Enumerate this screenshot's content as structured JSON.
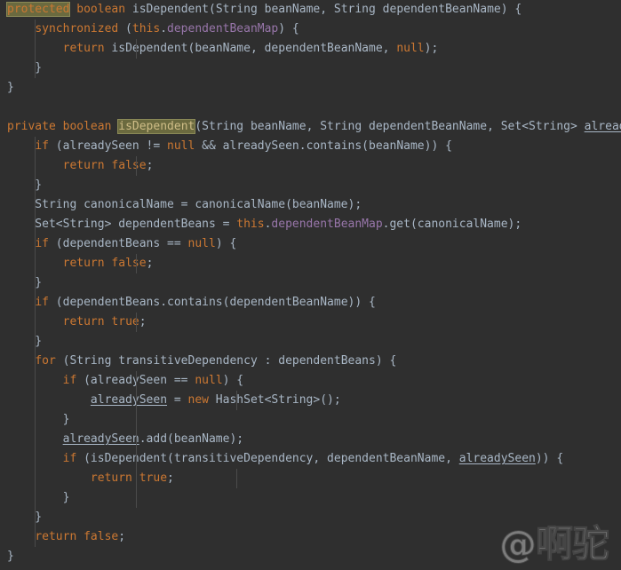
{
  "editor": {
    "language": "java",
    "background_color": "#2f2f2f",
    "default_text_color": "#a9b7c6",
    "keyword_color": "#cc7832",
    "field_color": "#9876aa",
    "indent_guide_color": "#4b4b4b",
    "search_highlight_color": "#6b6a3f",
    "search_highlight_border_color": "#8a8957"
  },
  "watermark": {
    "text": "@啊驼",
    "color": "#8a8a8a"
  },
  "code": {
    "lines": [
      {
        "n": 1,
        "guides": [],
        "text": "protected boolean isDependent(String beanName, String dependentBeanName) {"
      },
      {
        "n": 2,
        "guides": [
          8
        ],
        "text": "    synchronized (this.dependentBeanMap) {"
      },
      {
        "n": 3,
        "guides": [
          8,
          37
        ],
        "text": "        return isDependent(beanName, dependentBeanName, null);"
      },
      {
        "n": 4,
        "guides": [
          8
        ],
        "text": "    }"
      },
      {
        "n": 5,
        "guides": [],
        "text": "}"
      },
      {
        "n": 6,
        "guides": [],
        "text": ""
      },
      {
        "n": 7,
        "guides": [],
        "text": "private boolean isDependent(String beanName, String dependentBeanName, Set<String> alreadySeen) {"
      },
      {
        "n": 8,
        "guides": [
          8
        ],
        "text": "    if (alreadySeen != null && alreadySeen.contains(beanName)) {"
      },
      {
        "n": 9,
        "guides": [
          8,
          37
        ],
        "text": "        return false;"
      },
      {
        "n": 10,
        "guides": [
          8
        ],
        "text": "    }"
      },
      {
        "n": 11,
        "guides": [
          8
        ],
        "text": "    String canonicalName = canonicalName(beanName);"
      },
      {
        "n": 12,
        "guides": [
          8
        ],
        "text": "    Set<String> dependentBeans = this.dependentBeanMap.get(canonicalName);"
      },
      {
        "n": 13,
        "guides": [
          8
        ],
        "text": "    if (dependentBeans == null) {"
      },
      {
        "n": 14,
        "guides": [
          8,
          37
        ],
        "text": "        return false;"
      },
      {
        "n": 15,
        "guides": [
          8
        ],
        "text": "    }"
      },
      {
        "n": 16,
        "guides": [
          8
        ],
        "text": "    if (dependentBeans.contains(dependentBeanName)) {"
      },
      {
        "n": 17,
        "guides": [
          8,
          37
        ],
        "text": "        return true;"
      },
      {
        "n": 18,
        "guides": [
          8
        ],
        "text": "    }"
      },
      {
        "n": 19,
        "guides": [
          8
        ],
        "text": "    for (String transitiveDependency : dependentBeans) {"
      },
      {
        "n": 20,
        "guides": [
          8,
          37
        ],
        "text": "        if (alreadySeen == null) {"
      },
      {
        "n": 21,
        "guides": [
          8,
          37,
          66
        ],
        "text": "            alreadySeen = new HashSet<String>();"
      },
      {
        "n": 22,
        "guides": [
          8,
          37
        ],
        "text": "        }"
      },
      {
        "n": 23,
        "guides": [
          8,
          37
        ],
        "text": "        alreadySeen.add(beanName);"
      },
      {
        "n": 24,
        "guides": [
          8,
          37
        ],
        "text": "        if (isDependent(transitiveDependency, dependentBeanName, alreadySeen)) {"
      },
      {
        "n": 25,
        "guides": [
          8,
          37,
          66
        ],
        "text": "            return true;"
      },
      {
        "n": 26,
        "guides": [
          8,
          37
        ],
        "text": "        }"
      },
      {
        "n": 27,
        "guides": [
          8
        ],
        "text": "    }"
      },
      {
        "n": 28,
        "guides": [
          8
        ],
        "text": "    return false;"
      },
      {
        "n": 29,
        "guides": [],
        "text": "}"
      }
    ],
    "tokens": [
      {
        "line": 1,
        "parts": [
          {
            "t": "protected",
            "c": "hl"
          },
          {
            "t": " ",
            "c": "txt"
          },
          {
            "t": "boolean",
            "c": "kw"
          },
          {
            "t": " isDependent(String beanName, String dependentBeanName) {",
            "c": "txt"
          }
        ]
      },
      {
        "line": 2,
        "parts": [
          {
            "t": "    ",
            "c": "txt"
          },
          {
            "t": "synchronized",
            "c": "kw"
          },
          {
            "t": " (",
            "c": "txt"
          },
          {
            "t": "this",
            "c": "kw"
          },
          {
            "t": ".",
            "c": "txt"
          },
          {
            "t": "dependentBeanMap",
            "c": "fld"
          },
          {
            "t": ") {",
            "c": "txt"
          }
        ]
      },
      {
        "line": 3,
        "parts": [
          {
            "t": "        ",
            "c": "txt"
          },
          {
            "t": "return",
            "c": "kw"
          },
          {
            "t": " isDependent(beanName, dependentBeanName, ",
            "c": "txt"
          },
          {
            "t": "null",
            "c": "kw"
          },
          {
            "t": ");",
            "c": "txt"
          }
        ]
      },
      {
        "line": 4,
        "parts": [
          {
            "t": "    }",
            "c": "txt"
          }
        ]
      },
      {
        "line": 5,
        "parts": [
          {
            "t": "}",
            "c": "txt"
          }
        ]
      },
      {
        "line": 6,
        "parts": [
          {
            "t": "",
            "c": "txt"
          }
        ]
      },
      {
        "line": 7,
        "parts": [
          {
            "t": "private",
            "c": "kw"
          },
          {
            "t": " ",
            "c": "txt"
          },
          {
            "t": "boolean",
            "c": "kw"
          },
          {
            "t": " ",
            "c": "txt"
          },
          {
            "t": "isDependent",
            "c": "hl2"
          },
          {
            "t": "(String beanName, String dependentBeanName, Set<String> ",
            "c": "txt"
          },
          {
            "t": "alreadySeen",
            "c": "param"
          },
          {
            "t": ") {",
            "c": "txt"
          }
        ]
      },
      {
        "line": 8,
        "parts": [
          {
            "t": "    ",
            "c": "txt"
          },
          {
            "t": "if",
            "c": "kw"
          },
          {
            "t": " (alreadySeen != ",
            "c": "txt"
          },
          {
            "t": "null",
            "c": "kw"
          },
          {
            "t": " && alreadySeen.contains(beanName)) {",
            "c": "txt"
          }
        ]
      },
      {
        "line": 9,
        "parts": [
          {
            "t": "        ",
            "c": "txt"
          },
          {
            "t": "return",
            "c": "kw"
          },
          {
            "t": " ",
            "c": "txt"
          },
          {
            "t": "false",
            "c": "kw"
          },
          {
            "t": ";",
            "c": "txt"
          }
        ]
      },
      {
        "line": 10,
        "parts": [
          {
            "t": "    }",
            "c": "txt"
          }
        ]
      },
      {
        "line": 11,
        "parts": [
          {
            "t": "    String canonicalName = canonicalName(beanName);",
            "c": "txt"
          }
        ]
      },
      {
        "line": 12,
        "parts": [
          {
            "t": "    Set<String> dependentBeans = ",
            "c": "txt"
          },
          {
            "t": "this",
            "c": "kw"
          },
          {
            "t": ".",
            "c": "txt"
          },
          {
            "t": "dependentBeanMap",
            "c": "fld"
          },
          {
            "t": ".get(canonicalName);",
            "c": "txt"
          }
        ]
      },
      {
        "line": 13,
        "parts": [
          {
            "t": "    ",
            "c": "txt"
          },
          {
            "t": "if",
            "c": "kw"
          },
          {
            "t": " (dependentBeans == ",
            "c": "txt"
          },
          {
            "t": "null",
            "c": "kw"
          },
          {
            "t": ") {",
            "c": "txt"
          }
        ]
      },
      {
        "line": 14,
        "parts": [
          {
            "t": "        ",
            "c": "txt"
          },
          {
            "t": "return",
            "c": "kw"
          },
          {
            "t": " ",
            "c": "txt"
          },
          {
            "t": "false",
            "c": "kw"
          },
          {
            "t": ";",
            "c": "txt"
          }
        ]
      },
      {
        "line": 15,
        "parts": [
          {
            "t": "    }",
            "c": "txt"
          }
        ]
      },
      {
        "line": 16,
        "parts": [
          {
            "t": "    ",
            "c": "txt"
          },
          {
            "t": "if",
            "c": "kw"
          },
          {
            "t": " (dependentBeans.contains(dependentBeanName)) {",
            "c": "txt"
          }
        ]
      },
      {
        "line": 17,
        "parts": [
          {
            "t": "        ",
            "c": "txt"
          },
          {
            "t": "return",
            "c": "kw"
          },
          {
            "t": " ",
            "c": "txt"
          },
          {
            "t": "true",
            "c": "kw"
          },
          {
            "t": ";",
            "c": "txt"
          }
        ]
      },
      {
        "line": 18,
        "parts": [
          {
            "t": "    }",
            "c": "txt"
          }
        ]
      },
      {
        "line": 19,
        "parts": [
          {
            "t": "    ",
            "c": "txt"
          },
          {
            "t": "for",
            "c": "kw"
          },
          {
            "t": " (String transitiveDependency : dependentBeans) {",
            "c": "txt"
          }
        ]
      },
      {
        "line": 20,
        "parts": [
          {
            "t": "        ",
            "c": "txt"
          },
          {
            "t": "if",
            "c": "kw"
          },
          {
            "t": " (alreadySeen == ",
            "c": "txt"
          },
          {
            "t": "null",
            "c": "kw"
          },
          {
            "t": ") {",
            "c": "txt"
          }
        ]
      },
      {
        "line": 21,
        "parts": [
          {
            "t": "            ",
            "c": "txt"
          },
          {
            "t": "alreadySeen",
            "c": "param"
          },
          {
            "t": " = ",
            "c": "txt"
          },
          {
            "t": "new",
            "c": "kw"
          },
          {
            "t": " HashSet<String>();",
            "c": "txt"
          }
        ]
      },
      {
        "line": 22,
        "parts": [
          {
            "t": "        }",
            "c": "txt"
          }
        ]
      },
      {
        "line": 23,
        "parts": [
          {
            "t": "        ",
            "c": "txt"
          },
          {
            "t": "alreadySeen",
            "c": "param"
          },
          {
            "t": ".add(beanName);",
            "c": "txt"
          }
        ]
      },
      {
        "line": 24,
        "parts": [
          {
            "t": "        ",
            "c": "txt"
          },
          {
            "t": "if",
            "c": "kw"
          },
          {
            "t": " (isDependent(transitiveDependency, dependentBeanName, ",
            "c": "txt"
          },
          {
            "t": "alreadySeen",
            "c": "param"
          },
          {
            "t": ")) {",
            "c": "txt"
          }
        ]
      },
      {
        "line": 25,
        "parts": [
          {
            "t": "            ",
            "c": "txt"
          },
          {
            "t": "return",
            "c": "kw"
          },
          {
            "t": " ",
            "c": "txt"
          },
          {
            "t": "true",
            "c": "kw"
          },
          {
            "t": ";",
            "c": "txt"
          }
        ]
      },
      {
        "line": 26,
        "parts": [
          {
            "t": "        }",
            "c": "txt"
          }
        ]
      },
      {
        "line": 27,
        "parts": [
          {
            "t": "    }",
            "c": "txt"
          }
        ]
      },
      {
        "line": 28,
        "parts": [
          {
            "t": "    ",
            "c": "txt"
          },
          {
            "t": "return",
            "c": "kw"
          },
          {
            "t": " ",
            "c": "txt"
          },
          {
            "t": "false",
            "c": "kw"
          },
          {
            "t": ";",
            "c": "txt"
          }
        ]
      },
      {
        "line": 29,
        "parts": [
          {
            "t": "}",
            "c": "txt"
          }
        ]
      }
    ]
  }
}
